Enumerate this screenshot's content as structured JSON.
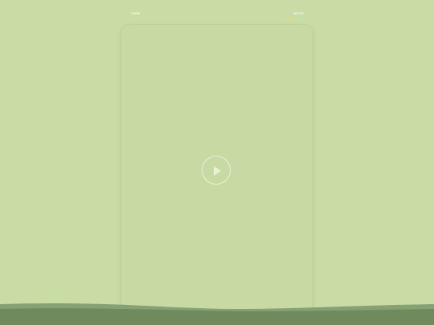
{
  "top_left_label": "TERM",
  "top_right_badge": {
    "icon": "spark-icon",
    "label": "MUTE"
  },
  "video": {
    "play_icon": "play-icon"
  },
  "colors": {
    "background": "#c9dca6",
    "ground_dark": "#6f8a5d",
    "ground_light": "#86a274",
    "accent": "#f2d96b"
  }
}
